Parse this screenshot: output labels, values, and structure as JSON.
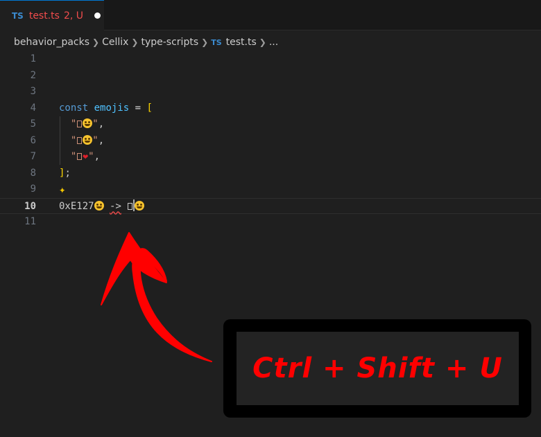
{
  "tab": {
    "badge": "TS",
    "name": "test.ts",
    "status": "2, U"
  },
  "breadcrumb": {
    "items": [
      "behavior_packs",
      "Cellix",
      "type-scripts"
    ],
    "file_badge": "TS",
    "file": "test.ts",
    "more": "..."
  },
  "editor": {
    "line_numbers": [
      "1",
      "2",
      "3",
      "4",
      "5",
      "6",
      "7",
      "8",
      "9",
      "10",
      "11"
    ],
    "active_line": "10",
    "line4": {
      "keyword": "const",
      "name": "emojis",
      "op": "=",
      "bracket": "["
    },
    "line8": {
      "bracket": "]",
      "punct": ";"
    },
    "line10": {
      "hex": "0xE127",
      "arrow": "->"
    },
    "quote": "\"",
    "comma": ","
  },
  "annotation": {
    "text": "Ctrl + Shift + U",
    "color": "#ff0000"
  },
  "colors": {
    "accent": "#0078d4",
    "error": "#f14c4c",
    "keyword": "#569cd6",
    "variable": "#4fc1ff",
    "string": "#ce9178",
    "bracket": "#ffd700"
  }
}
